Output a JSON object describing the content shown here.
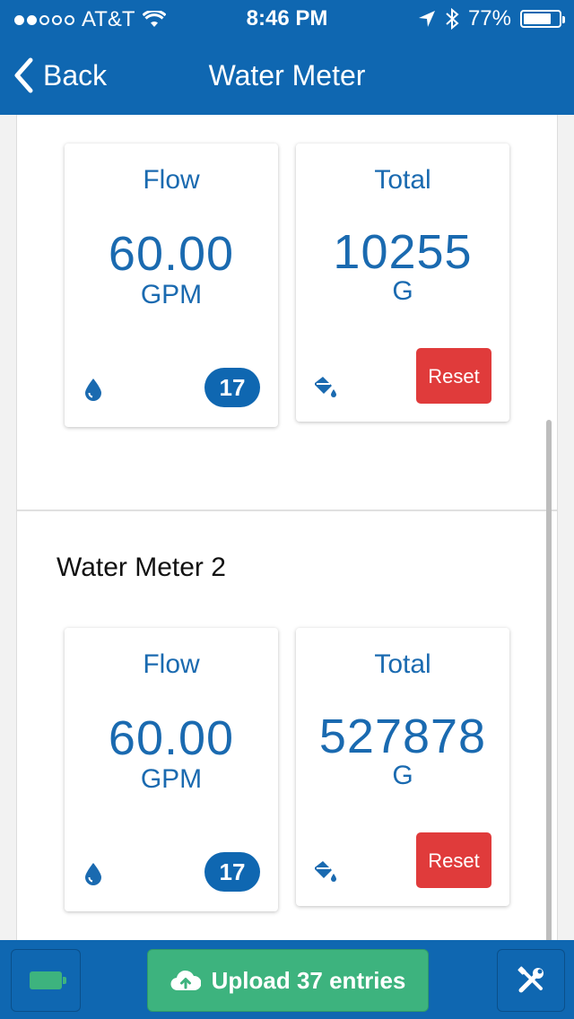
{
  "status_bar": {
    "carrier": "AT&T",
    "time": "8:46 PM",
    "battery_percent": "77%",
    "battery_level": 0.77,
    "signal_bars": 2
  },
  "nav": {
    "back_label": "Back",
    "title": "Water Meter"
  },
  "meter1": {
    "flow": {
      "label": "Flow",
      "value": "60.00",
      "unit": "GPM",
      "badge": "17",
      "icon": "water-drop-icon"
    },
    "total": {
      "label": "Total",
      "value": "10255",
      "unit": "G",
      "reset_label": "Reset",
      "icon": "paint-bucket-icon"
    }
  },
  "meter2": {
    "title": "Water Meter 2",
    "flow": {
      "label": "Flow",
      "value": "60.00",
      "unit": "GPM",
      "badge": "17",
      "icon": "water-drop-icon"
    },
    "total": {
      "label": "Total",
      "value": "527878",
      "unit": "G",
      "reset_label": "Reset",
      "icon": "paint-bucket-icon"
    }
  },
  "toolbar": {
    "battery_icon": "battery-icon",
    "upload_label": "Upload 37 entries",
    "upload_icon": "cloud-upload-icon",
    "tools_icon": "tools-icon"
  },
  "colors": {
    "brand": "#0f67b1",
    "text_blue": "#1a6ab0",
    "reset_red": "#e03b3b",
    "upload_green": "#3db37e"
  }
}
